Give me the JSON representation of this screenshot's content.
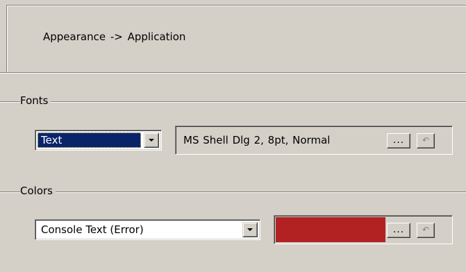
{
  "header": {
    "title": "Appearance -> Application"
  },
  "fonts_group": {
    "label": "Fonts",
    "combo_value": "Text",
    "font_value": "MS Shell Dlg 2,  8pt,  Normal",
    "browse_label": "...",
    "reset_icon": "undo-arrow-icon"
  },
  "colors_group": {
    "label": "Colors",
    "combo_value": "Console Text (Error)",
    "color_value": "#b22222",
    "browse_label": "...",
    "reset_icon": "undo-arrow-icon"
  }
}
